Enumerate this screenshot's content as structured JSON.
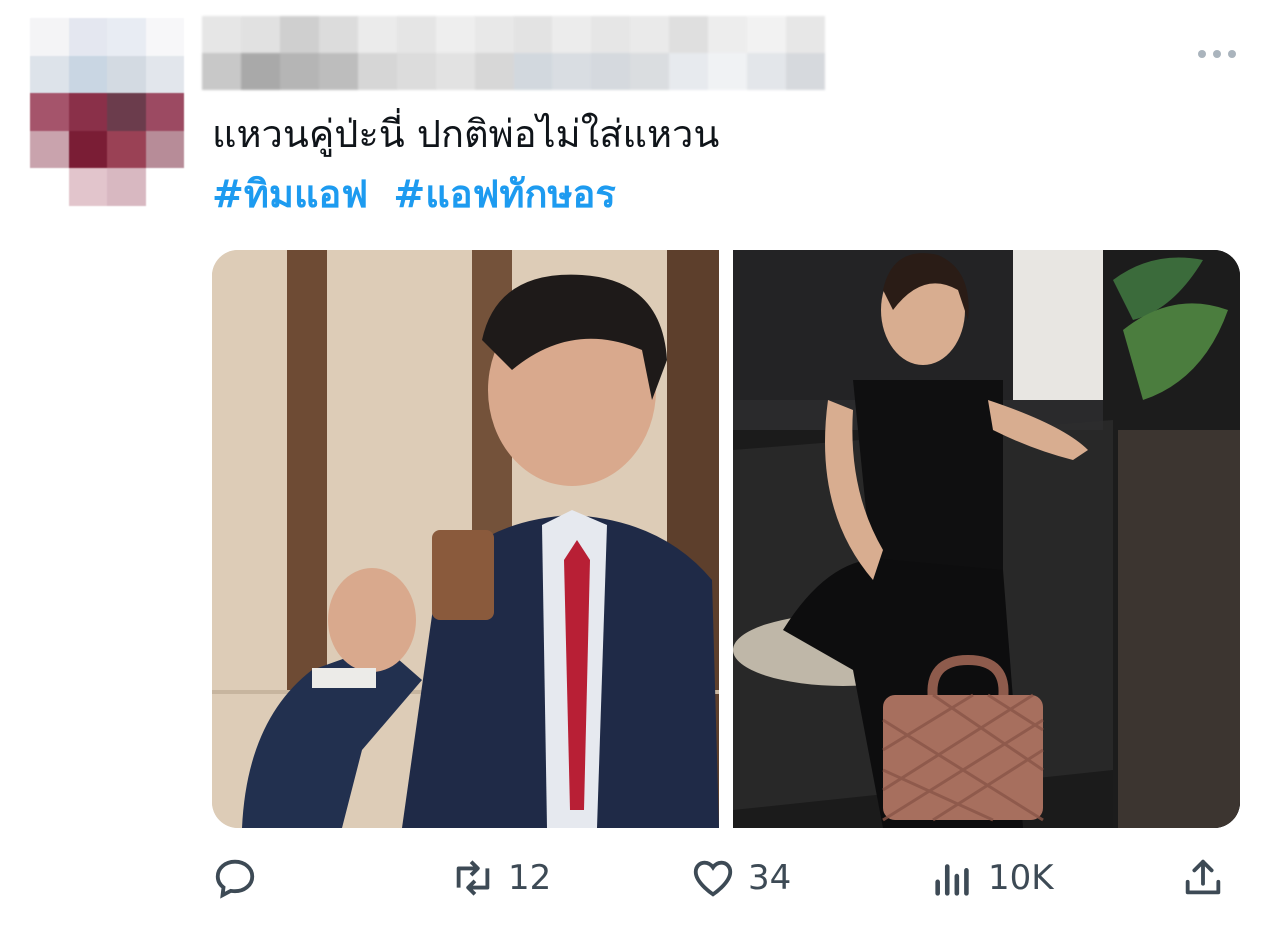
{
  "tweet": {
    "text_line1": "แหวนคู่ป่ะนี่ ปกติพ่อไม่ใส่แหวน",
    "hashtags": [
      "#ทิมแอฟ",
      "#แอฟทักษอร"
    ]
  },
  "actions": {
    "reply": {
      "icon": "reply-icon",
      "count": ""
    },
    "retweet": {
      "icon": "retweet-icon",
      "count": "12"
    },
    "like": {
      "icon": "heart-icon",
      "count": "34"
    },
    "views": {
      "icon": "views-icon",
      "count": "10K"
    },
    "share": {
      "icon": "share-icon",
      "count": ""
    }
  },
  "colors": {
    "hashtag": "#1d9bf0",
    "icon": "#3d4a55",
    "text": "#0f1419"
  }
}
